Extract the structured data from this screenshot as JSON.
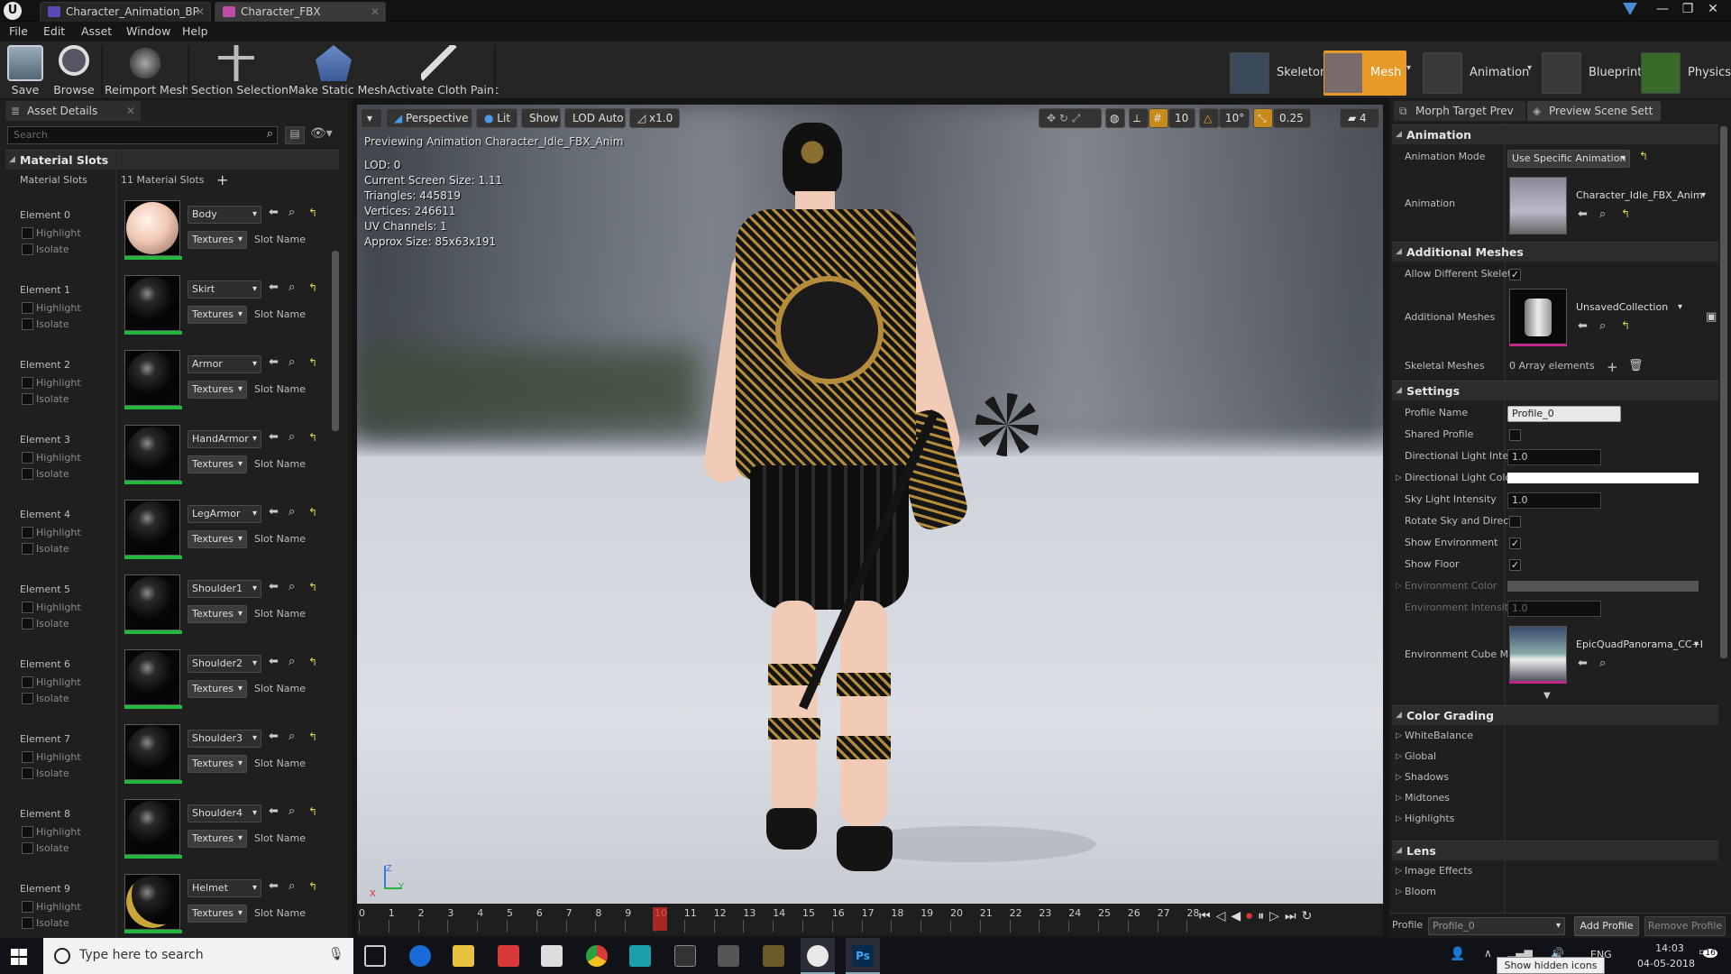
{
  "window": {
    "tabs": [
      {
        "label": "Character_Animation_BP",
        "color": "#5a4ab8"
      },
      {
        "label": "Character_FBX",
        "color": "#c04ca8"
      }
    ],
    "controls": [
      "—",
      "❐",
      "✕"
    ]
  },
  "menu": [
    "File",
    "Edit",
    "Asset",
    "Window",
    "Help"
  ],
  "toolbar": {
    "buttons": [
      "Save",
      "Browse",
      "Reimport Mesh",
      "Section Selection",
      "Make Static Mesh",
      "Activate Cloth Paint"
    ]
  },
  "modes": [
    "Skeleton",
    "Mesh",
    "Animation",
    "Blueprint",
    "Physics"
  ],
  "left_panel": {
    "tab": "Asset Details",
    "search_placeholder": "Search",
    "section": "Material Slots",
    "slots_label": "Material Slots",
    "slots_count": "11 Material Slots",
    "highlight_label": "Highlight",
    "isolate_label": "Isolate",
    "textures_label": "Textures",
    "slot_name_label": "Slot Name",
    "elements": [
      {
        "label": "Element 0",
        "material": "Body"
      },
      {
        "label": "Element 1",
        "material": "Skirt"
      },
      {
        "label": "Element 2",
        "material": "Armor"
      },
      {
        "label": "Element 3",
        "material": "HandArmor"
      },
      {
        "label": "Element 4",
        "material": "LegArmor"
      },
      {
        "label": "Element 5",
        "material": "Shoulder1"
      },
      {
        "label": "Element 6",
        "material": "Shoulder2"
      },
      {
        "label": "Element 7",
        "material": "Shoulder3"
      },
      {
        "label": "Element 8",
        "material": "Shoulder4"
      },
      {
        "label": "Element 9",
        "material": "Helmet"
      }
    ]
  },
  "viewport": {
    "perspective": "Perspective",
    "lit": "Lit",
    "show": "Show",
    "lod": "LOD Auto",
    "speed": "x1.0",
    "grid": "10",
    "angle": "10°",
    "scale": "0.25",
    "camspeed": "4",
    "preview": "Previewing Animation Character_Idle_FBX_Anim",
    "stats": [
      "LOD: 0",
      "Current Screen Size: 1.11",
      "Triangles: 445819",
      "Vertices: 246611",
      "UV Channels: 1",
      "Approx Size: 85x63x191"
    ]
  },
  "timeline": {
    "ticks": [
      "0",
      "1",
      "2",
      "3",
      "4",
      "5",
      "6",
      "7",
      "8",
      "9",
      "10",
      "11",
      "12",
      "13",
      "14",
      "15",
      "16",
      "17",
      "18",
      "19",
      "20",
      "21",
      "22",
      "23",
      "24",
      "25",
      "26",
      "27",
      "28"
    ],
    "current": "10"
  },
  "right_panel": {
    "tabs": [
      "Morph Target Prev",
      "Preview Scene Sett"
    ],
    "animation": {
      "title": "Animation",
      "mode_label": "Animation Mode",
      "mode_value": "Use Specific Animation",
      "anim_label": "Animation",
      "anim_value": "Character_Idle_FBX_Anim"
    },
    "additional": {
      "title": "Additional Meshes",
      "allow_label": "Allow Different Skelet",
      "meshes_label": "Additional Meshes",
      "meshes_value": "UnsavedCollection",
      "skeletal_label": "Skeletal Meshes",
      "skeletal_value": "0 Array elements"
    },
    "settings": {
      "title": "Settings",
      "profile_label": "Profile Name",
      "profile_value": "Profile_0",
      "shared_label": "Shared Profile",
      "dli_label": "Directional Light Inten",
      "dli_value": "1.0",
      "dlc_label": "Directional Light Colo",
      "sli_label": "Sky Light Intensity",
      "sli_value": "1.0",
      "rotate_label": "Rotate Sky and Direct",
      "showenv_label": "Show Environment",
      "showfloor_label": "Show Floor",
      "envcolor_label": "Environment Color",
      "envint_label": "Environment Intensity",
      "envint_value": "1.0",
      "cube_label": "Environment Cube Ma",
      "cube_value": "EpicQuadPanorama_CC+E"
    },
    "color_grading": {
      "title": "Color Grading",
      "items": [
        "WhiteBalance",
        "Global",
        "Shadows",
        "Midtones",
        "Highlights"
      ]
    },
    "lens": {
      "title": "Lens",
      "items": [
        "Image Effects",
        "Bloom"
      ]
    },
    "footer": {
      "profile_label": "Profile",
      "profile_value": "Profile_0",
      "add": "Add Profile",
      "remove": "Remove Profile"
    }
  },
  "taskbar": {
    "search_placeholder": "Type here to search",
    "lang": "ENG",
    "time": "14:03",
    "date": "04-05-2018",
    "tooltip": "Show hidden icons",
    "notif": "16"
  }
}
